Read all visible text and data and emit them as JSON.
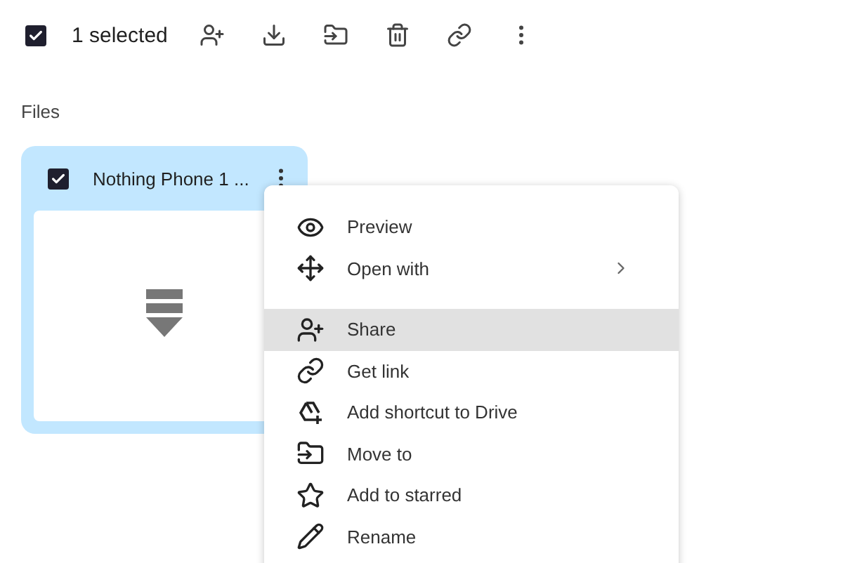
{
  "toolbar": {
    "select_all": {
      "checked": true
    },
    "selection_label": "1 selected"
  },
  "section_title": "Files",
  "file_card": {
    "name": "Nothing Phone 1 ...",
    "checked": true,
    "selected": true
  },
  "context_menu": {
    "items": [
      {
        "label": "Preview",
        "selected": false,
        "has_submenu": false,
        "divider_after": false
      },
      {
        "label": "Open with",
        "selected": false,
        "has_submenu": true,
        "divider_after": true
      },
      {
        "label": "Share",
        "selected": true,
        "has_submenu": false,
        "divider_after": false
      },
      {
        "label": "Get link",
        "selected": false,
        "has_submenu": false,
        "divider_after": false
      },
      {
        "label": "Add shortcut to Drive",
        "selected": false,
        "has_submenu": false,
        "divider_after": false
      },
      {
        "label": "Move to",
        "selected": false,
        "has_submenu": false,
        "divider_after": false
      },
      {
        "label": "Add to starred",
        "selected": false,
        "has_submenu": false,
        "divider_after": false
      },
      {
        "label": "Rename",
        "selected": false,
        "has_submenu": false,
        "divider_after": false
      }
    ]
  }
}
